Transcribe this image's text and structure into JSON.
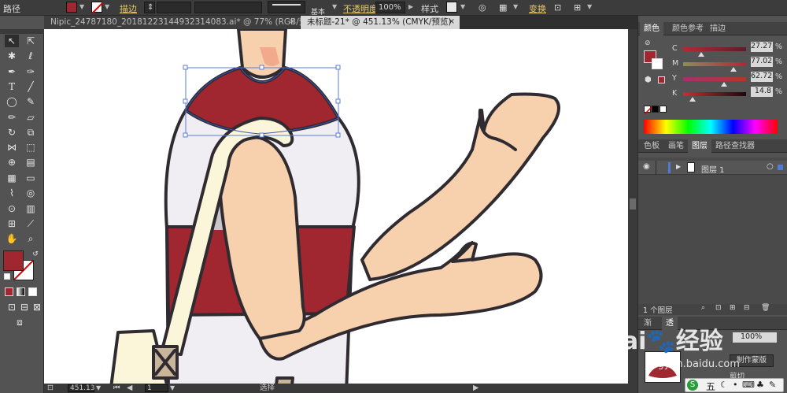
{
  "control_bar": {
    "path_label": "路径",
    "stroke_label": "描边",
    "stroke_style": "基本",
    "opacity_label": "不透明度",
    "opacity_value": "100%",
    "style_label": "样式",
    "transform_label": "变换",
    "fill_color": "#a0272f"
  },
  "tabs": [
    {
      "label": "Nipic_24787180_20181223144932314083.ai* @ 77% (RGB/预览)",
      "close": "×"
    },
    {
      "label": "未标题-21* @ 451.13% (CMYK/预览)",
      "close": "×"
    }
  ],
  "status": {
    "zoom": "451.13",
    "page": "1",
    "tool": "选择"
  },
  "color_panel": {
    "tabs": [
      "颜色",
      "颜色参考",
      "描边"
    ],
    "sliders": [
      {
        "label": "C",
        "value": "27.27",
        "unit": "%"
      },
      {
        "label": "M",
        "value": "77.02",
        "unit": "%"
      },
      {
        "label": "Y",
        "value": "62.72",
        "unit": "%"
      },
      {
        "label": "K",
        "value": "14.8",
        "unit": "%"
      }
    ]
  },
  "layers_panel": {
    "tabs": [
      "色板",
      "画笔",
      "图层",
      "路径查找器"
    ],
    "layer_name": "图层 1",
    "layer_count": "1 个图层"
  },
  "bottom_panel": {
    "tab1": "渐",
    "tab2": "透",
    "opacity": "100%",
    "make_mask": "制作蒙版",
    "clip": "剪切"
  },
  "watermark": {
    "brand": "Bai",
    "brand2": "经验",
    "url": "jingyan.baidu.com"
  },
  "ime": {
    "label": "五"
  },
  "colors": {
    "accent_red": "#a0272f",
    "skin": "#f7d1ad",
    "bag": "#fbf6da",
    "outline": "#2f2b30"
  }
}
